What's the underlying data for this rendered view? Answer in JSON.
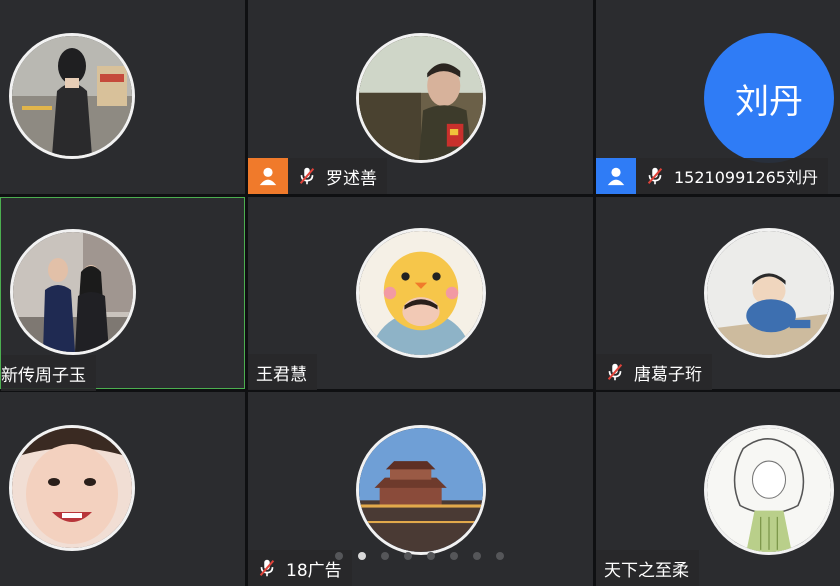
{
  "colors": {
    "tile_bg": "#2b2c2f",
    "active_border": "#4caf50",
    "role_orange": "#f07a2b",
    "role_blue": "#2f7cf6",
    "mic_muted_red": "#e0433a",
    "text_avatar_bg": "#2f7cf6"
  },
  "participants": [
    {
      "name": "",
      "avatar": "photo-girl-walking"
    },
    {
      "name": "罗述善",
      "avatar": "photo-man-car-window",
      "role_icon": "user-icon",
      "muted": true
    },
    {
      "name": "15210991265刘丹",
      "avatar_text": "刘丹",
      "role_icon": "user-icon",
      "muted": true
    },
    {
      "name": "新传周子玉",
      "avatar": "photo-graduation-couple",
      "active": true
    },
    {
      "name": "王君慧",
      "avatar": "cartoon-chick-hat"
    },
    {
      "name": "唐葛子珩",
      "avatar": "illustration-boy-sitting",
      "muted": true
    },
    {
      "name": "",
      "avatar": "photo-smiling-child"
    },
    {
      "name": "18广告",
      "avatar": "photo-city-gate-night",
      "muted": true
    },
    {
      "name": "天下之至柔",
      "avatar": "sketch-girl-illustration"
    }
  ],
  "pagination": {
    "pages": 8,
    "current": 2
  }
}
